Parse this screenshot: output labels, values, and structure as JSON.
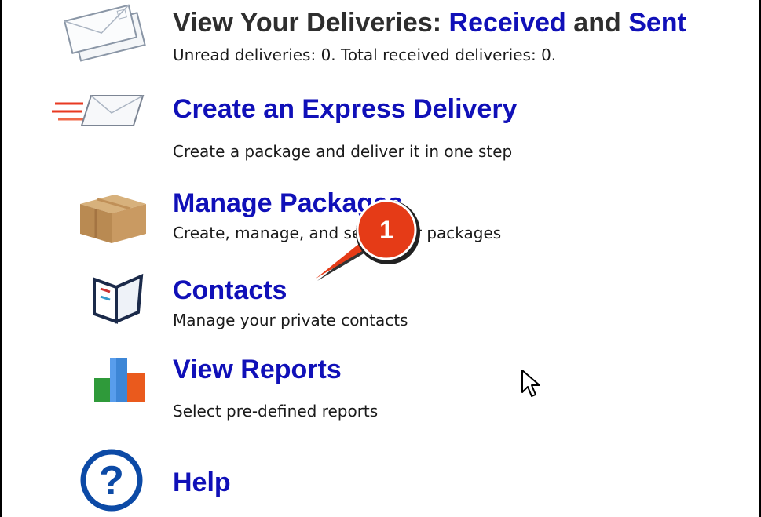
{
  "menu": {
    "deliveries": {
      "title_lead": "View Your Deliveries: ",
      "title_received": "Received",
      "title_and": " and ",
      "title_sent": "Sent",
      "description": "Unread deliveries: 0. Total received deliveries: 0.",
      "icon": "envelopes-icon"
    },
    "express": {
      "title": "Create an Express Delivery",
      "description": "Create a package and deliver it in one step",
      "icon": "express-envelope-icon"
    },
    "packages": {
      "title": "Manage Packages",
      "description": "Create, manage, and send your packages",
      "icon": "package-box-icon"
    },
    "contacts": {
      "title": "Contacts",
      "description": "Manage your private contacts",
      "icon": "address-book-icon"
    },
    "reports": {
      "title": "View Reports",
      "description": "Select pre-defined reports",
      "icon": "bar-chart-icon"
    },
    "help": {
      "title": "Help",
      "icon": "help-question-icon"
    }
  },
  "callout": {
    "number": "1",
    "color": "#e53b17"
  },
  "colors": {
    "link": "#1010b8",
    "heading_dark": "#2e2e2e",
    "text": "#1a1a1a"
  }
}
